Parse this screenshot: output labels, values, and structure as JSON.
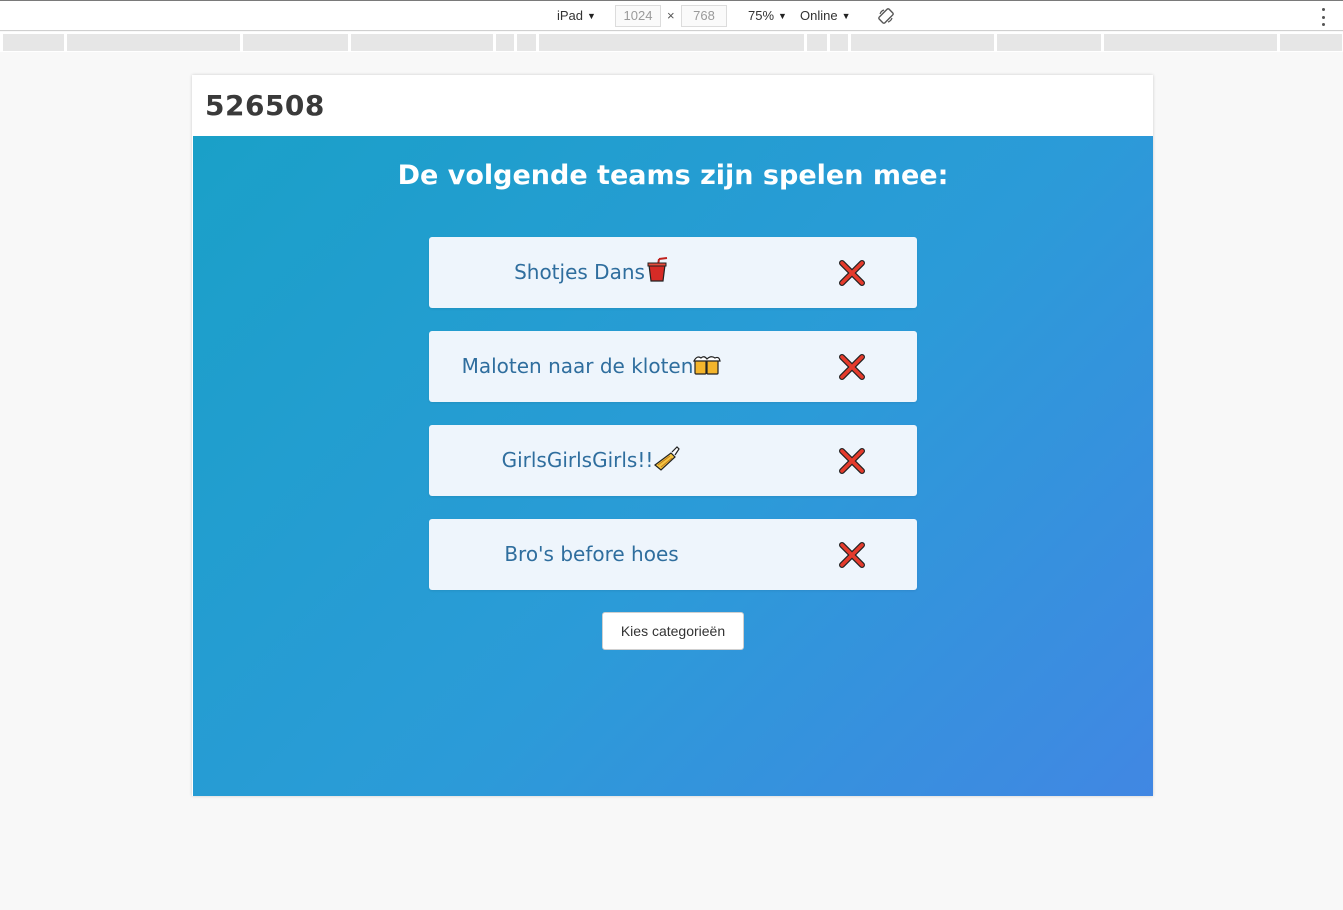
{
  "devtools": {
    "device": "iPad",
    "width": "1024",
    "height": "768",
    "times": "×",
    "zoom": "75%",
    "network": "Online"
  },
  "game": {
    "code": "526508",
    "heading": "De volgende teams zijn spelen mee:",
    "teams": [
      {
        "name": "Shotjes Dans",
        "emoji": "cup-with-straw-icon"
      },
      {
        "name": "Maloten naar de kloten",
        "emoji": "beer-mugs-icon"
      },
      {
        "name": "GirlsGirlsGirls!!",
        "emoji": "nail-polish-icon"
      },
      {
        "name": "Bro's before hoes",
        "emoji": ""
      }
    ],
    "choose_label": "Kies categorieën"
  },
  "colors": {
    "gradient_start": "#1aa0c8",
    "gradient_end": "#4187e3",
    "card_bg": "#eef5fc",
    "team_text": "#2f6e9e",
    "remove_red": "#e53b2c"
  }
}
